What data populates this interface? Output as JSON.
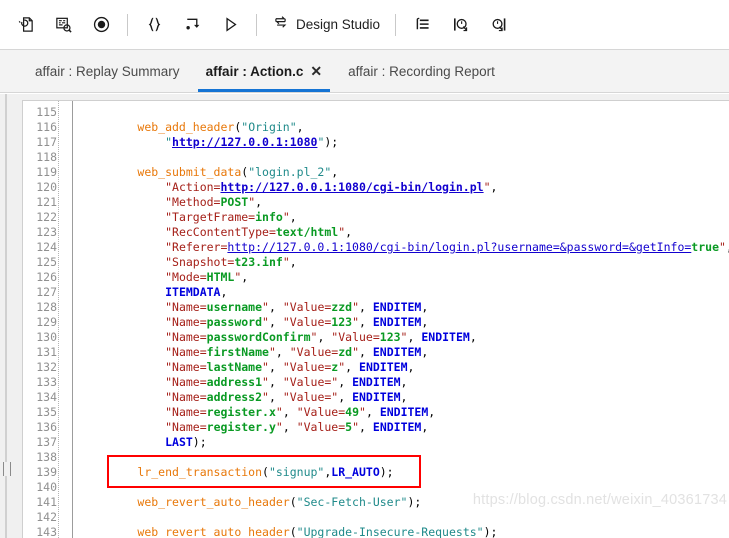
{
  "toolbar": {
    "items": [
      {
        "name": "replay-script-icon",
        "label": "",
        "type": "icon"
      },
      {
        "name": "compile-script-icon",
        "label": "",
        "type": "icon"
      },
      {
        "name": "record-icon",
        "label": "",
        "type": "icon"
      },
      {
        "name": "separator-1",
        "label": "",
        "type": "separator"
      },
      {
        "name": "braces-icon",
        "label": "",
        "type": "icon"
      },
      {
        "name": "step-into-icon",
        "label": "",
        "type": "icon"
      },
      {
        "name": "run-icon",
        "label": "",
        "type": "icon"
      },
      {
        "name": "separator-2",
        "label": "",
        "type": "separator"
      },
      {
        "name": "design-studio-button",
        "label": "Design Studio",
        "type": "labeled"
      },
      {
        "name": "separator-3",
        "label": "",
        "type": "separator"
      },
      {
        "name": "snapshot-list-icon",
        "label": "",
        "type": "icon"
      },
      {
        "name": "start-transaction-icon",
        "label": "",
        "type": "icon"
      },
      {
        "name": "end-transaction-icon",
        "label": "",
        "type": "icon"
      }
    ],
    "design_studio_label": "Design Studio"
  },
  "tabs": [
    {
      "label": "affair : Replay Summary",
      "active": false,
      "closable": false
    },
    {
      "label": "affair : Action.c",
      "active": true,
      "closable": true,
      "close_glyph": "✕"
    },
    {
      "label": "affair : Recording Report",
      "active": false,
      "closable": false
    }
  ],
  "editor": {
    "first_line_number": 115,
    "lines": [
      {
        "n": 115,
        "tokens": []
      },
      {
        "n": 116,
        "tokens": [
          {
            "t": "plain",
            "s": "        "
          },
          {
            "t": "fn",
            "s": "web_add_header"
          },
          {
            "t": "plain",
            "s": "("
          },
          {
            "t": "str",
            "s": "\"Origin\""
          },
          {
            "t": "plain",
            "s": ","
          }
        ]
      },
      {
        "n": 117,
        "tokens": [
          {
            "t": "plain",
            "s": "            "
          },
          {
            "t": "str",
            "s": "\""
          },
          {
            "t": "url",
            "s": "http://127.0.0.1:1080"
          },
          {
            "t": "str",
            "s": "\""
          },
          {
            "t": "plain",
            "s": ");"
          }
        ]
      },
      {
        "n": 118,
        "tokens": []
      },
      {
        "n": 119,
        "tokens": [
          {
            "t": "plain",
            "s": "        "
          },
          {
            "t": "fn",
            "s": "web_submit_data"
          },
          {
            "t": "plain",
            "s": "("
          },
          {
            "t": "str",
            "s": "\"login.pl_2\""
          },
          {
            "t": "plain",
            "s": ","
          }
        ]
      },
      {
        "n": 120,
        "tokens": [
          {
            "t": "plain",
            "s": "            "
          },
          {
            "t": "key",
            "s": "\"Action="
          },
          {
            "t": "url",
            "s": "http://127.0.0.1:1080/cgi-bin/login.pl"
          },
          {
            "t": "key",
            "s": "\""
          },
          {
            "t": "plain",
            "s": ","
          }
        ]
      },
      {
        "n": 121,
        "tokens": [
          {
            "t": "plain",
            "s": "            "
          },
          {
            "t": "key",
            "s": "\"Method="
          },
          {
            "t": "val",
            "s": "POST"
          },
          {
            "t": "key",
            "s": "\""
          },
          {
            "t": "plain",
            "s": ","
          }
        ]
      },
      {
        "n": 122,
        "tokens": [
          {
            "t": "plain",
            "s": "            "
          },
          {
            "t": "key",
            "s": "\"TargetFrame="
          },
          {
            "t": "val",
            "s": "info"
          },
          {
            "t": "key",
            "s": "\""
          },
          {
            "t": "plain",
            "s": ","
          }
        ]
      },
      {
        "n": 123,
        "tokens": [
          {
            "t": "plain",
            "s": "            "
          },
          {
            "t": "key",
            "s": "\"RecContentType="
          },
          {
            "t": "val",
            "s": "text/html"
          },
          {
            "t": "key",
            "s": "\""
          },
          {
            "t": "plain",
            "s": ","
          }
        ]
      },
      {
        "n": 124,
        "tokens": [
          {
            "t": "plain",
            "s": "            "
          },
          {
            "t": "key",
            "s": "\"Referer="
          },
          {
            "t": "url2",
            "s": "http://127.0.0.1:1080/cgi-bin/login.pl?username=&password=&getInfo="
          },
          {
            "t": "val",
            "s": "true"
          },
          {
            "t": "key",
            "s": "\""
          },
          {
            "t": "plain",
            "s": ","
          }
        ]
      },
      {
        "n": 125,
        "tokens": [
          {
            "t": "plain",
            "s": "            "
          },
          {
            "t": "key",
            "s": "\"Snapshot="
          },
          {
            "t": "val",
            "s": "t23.inf"
          },
          {
            "t": "key",
            "s": "\""
          },
          {
            "t": "plain",
            "s": ","
          }
        ]
      },
      {
        "n": 126,
        "tokens": [
          {
            "t": "plain",
            "s": "            "
          },
          {
            "t": "key",
            "s": "\"Mode="
          },
          {
            "t": "val",
            "s": "HTML"
          },
          {
            "t": "key",
            "s": "\""
          },
          {
            "t": "plain",
            "s": ","
          }
        ]
      },
      {
        "n": 127,
        "tokens": [
          {
            "t": "plain",
            "s": "            "
          },
          {
            "t": "kw",
            "s": "ITEMDATA"
          },
          {
            "t": "plain",
            "s": ","
          }
        ]
      },
      {
        "n": 128,
        "tokens": [
          {
            "t": "plain",
            "s": "            "
          },
          {
            "t": "key",
            "s": "\"Name="
          },
          {
            "t": "val",
            "s": "username"
          },
          {
            "t": "key",
            "s": "\""
          },
          {
            "t": "plain",
            "s": ", "
          },
          {
            "t": "key",
            "s": "\"Value="
          },
          {
            "t": "val",
            "s": "zzd"
          },
          {
            "t": "key",
            "s": "\""
          },
          {
            "t": "plain",
            "s": ", "
          },
          {
            "t": "kw",
            "s": "ENDITEM"
          },
          {
            "t": "plain",
            "s": ","
          }
        ]
      },
      {
        "n": 129,
        "tokens": [
          {
            "t": "plain",
            "s": "            "
          },
          {
            "t": "key",
            "s": "\"Name="
          },
          {
            "t": "val",
            "s": "password"
          },
          {
            "t": "key",
            "s": "\""
          },
          {
            "t": "plain",
            "s": ", "
          },
          {
            "t": "key",
            "s": "\"Value="
          },
          {
            "t": "val",
            "s": "123"
          },
          {
            "t": "key",
            "s": "\""
          },
          {
            "t": "plain",
            "s": ", "
          },
          {
            "t": "kw",
            "s": "ENDITEM"
          },
          {
            "t": "plain",
            "s": ","
          }
        ]
      },
      {
        "n": 130,
        "tokens": [
          {
            "t": "plain",
            "s": "            "
          },
          {
            "t": "key",
            "s": "\"Name="
          },
          {
            "t": "val",
            "s": "passwordConfirm"
          },
          {
            "t": "key",
            "s": "\""
          },
          {
            "t": "plain",
            "s": ", "
          },
          {
            "t": "key",
            "s": "\"Value="
          },
          {
            "t": "val",
            "s": "123"
          },
          {
            "t": "key",
            "s": "\""
          },
          {
            "t": "plain",
            "s": ", "
          },
          {
            "t": "kw",
            "s": "ENDITEM"
          },
          {
            "t": "plain",
            "s": ","
          }
        ]
      },
      {
        "n": 131,
        "tokens": [
          {
            "t": "plain",
            "s": "            "
          },
          {
            "t": "key",
            "s": "\"Name="
          },
          {
            "t": "val",
            "s": "firstName"
          },
          {
            "t": "key",
            "s": "\""
          },
          {
            "t": "plain",
            "s": ", "
          },
          {
            "t": "key",
            "s": "\"Value="
          },
          {
            "t": "val",
            "s": "zd"
          },
          {
            "t": "key",
            "s": "\""
          },
          {
            "t": "plain",
            "s": ", "
          },
          {
            "t": "kw",
            "s": "ENDITEM"
          },
          {
            "t": "plain",
            "s": ","
          }
        ]
      },
      {
        "n": 132,
        "tokens": [
          {
            "t": "plain",
            "s": "            "
          },
          {
            "t": "key",
            "s": "\"Name="
          },
          {
            "t": "val",
            "s": "lastName"
          },
          {
            "t": "key",
            "s": "\""
          },
          {
            "t": "plain",
            "s": ", "
          },
          {
            "t": "key",
            "s": "\"Value="
          },
          {
            "t": "val",
            "s": "z"
          },
          {
            "t": "key",
            "s": "\""
          },
          {
            "t": "plain",
            "s": ", "
          },
          {
            "t": "kw",
            "s": "ENDITEM"
          },
          {
            "t": "plain",
            "s": ","
          }
        ]
      },
      {
        "n": 133,
        "tokens": [
          {
            "t": "plain",
            "s": "            "
          },
          {
            "t": "key",
            "s": "\"Name="
          },
          {
            "t": "val",
            "s": "address1"
          },
          {
            "t": "key",
            "s": "\""
          },
          {
            "t": "plain",
            "s": ", "
          },
          {
            "t": "key",
            "s": "\"Value=\""
          },
          {
            "t": "plain",
            "s": ", "
          },
          {
            "t": "kw",
            "s": "ENDITEM"
          },
          {
            "t": "plain",
            "s": ","
          }
        ]
      },
      {
        "n": 134,
        "tokens": [
          {
            "t": "plain",
            "s": "            "
          },
          {
            "t": "key",
            "s": "\"Name="
          },
          {
            "t": "val",
            "s": "address2"
          },
          {
            "t": "key",
            "s": "\""
          },
          {
            "t": "plain",
            "s": ", "
          },
          {
            "t": "key",
            "s": "\"Value=\""
          },
          {
            "t": "plain",
            "s": ", "
          },
          {
            "t": "kw",
            "s": "ENDITEM"
          },
          {
            "t": "plain",
            "s": ","
          }
        ]
      },
      {
        "n": 135,
        "tokens": [
          {
            "t": "plain",
            "s": "            "
          },
          {
            "t": "key",
            "s": "\"Name="
          },
          {
            "t": "val",
            "s": "register.x"
          },
          {
            "t": "key",
            "s": "\""
          },
          {
            "t": "plain",
            "s": ", "
          },
          {
            "t": "key",
            "s": "\"Value="
          },
          {
            "t": "val",
            "s": "49"
          },
          {
            "t": "key",
            "s": "\""
          },
          {
            "t": "plain",
            "s": ", "
          },
          {
            "t": "kw",
            "s": "ENDITEM"
          },
          {
            "t": "plain",
            "s": ","
          }
        ]
      },
      {
        "n": 136,
        "tokens": [
          {
            "t": "plain",
            "s": "            "
          },
          {
            "t": "key",
            "s": "\"Name="
          },
          {
            "t": "val",
            "s": "register.y"
          },
          {
            "t": "key",
            "s": "\""
          },
          {
            "t": "plain",
            "s": ", "
          },
          {
            "t": "key",
            "s": "\"Value="
          },
          {
            "t": "val",
            "s": "5"
          },
          {
            "t": "key",
            "s": "\""
          },
          {
            "t": "plain",
            "s": ", "
          },
          {
            "t": "kw",
            "s": "ENDITEM"
          },
          {
            "t": "plain",
            "s": ","
          }
        ]
      },
      {
        "n": 137,
        "tokens": [
          {
            "t": "plain",
            "s": "            "
          },
          {
            "t": "kw",
            "s": "LAST"
          },
          {
            "t": "plain",
            "s": ");"
          }
        ]
      },
      {
        "n": 138,
        "tokens": []
      },
      {
        "n": 139,
        "tokens": [
          {
            "t": "plain",
            "s": "        "
          },
          {
            "t": "fn",
            "s": "lr_end_transaction"
          },
          {
            "t": "plain",
            "s": "("
          },
          {
            "t": "str",
            "s": "\"signup\""
          },
          {
            "t": "plain",
            "s": ","
          },
          {
            "t": "kw",
            "s": "LR_AUTO"
          },
          {
            "t": "plain",
            "s": ");"
          }
        ]
      },
      {
        "n": 140,
        "tokens": []
      },
      {
        "n": 141,
        "tokens": [
          {
            "t": "plain",
            "s": "        "
          },
          {
            "t": "fn",
            "s": "web_revert_auto_header"
          },
          {
            "t": "plain",
            "s": "("
          },
          {
            "t": "str",
            "s": "\"Sec-Fetch-User\""
          },
          {
            "t": "plain",
            "s": ");"
          }
        ]
      },
      {
        "n": 142,
        "tokens": []
      },
      {
        "n": 143,
        "tokens": [
          {
            "t": "plain",
            "s": "        "
          },
          {
            "t": "fn",
            "s": "web_revert_auto_header"
          },
          {
            "t": "plain",
            "s": "("
          },
          {
            "t": "str",
            "s": "\"Upgrade-Insecure-Requests\""
          },
          {
            "t": "plain",
            "s": ");"
          }
        ]
      }
    ]
  },
  "annotation": {
    "red_box_highlight_line": 139,
    "color": "#ff0000"
  },
  "watermark": {
    "text": "https://blog.csdn.net/weixin_40361734",
    "color": "#e2e2e2"
  },
  "colors": {
    "function": "#e8780a",
    "string": "#1f8a8a",
    "keyword": "#0000dd",
    "attr_key": "#a52019",
    "attr_value": "#0a9a23",
    "url": "#1200cf",
    "tab_accent": "#1574d4",
    "chrome_bg": "#f3f3f3"
  }
}
